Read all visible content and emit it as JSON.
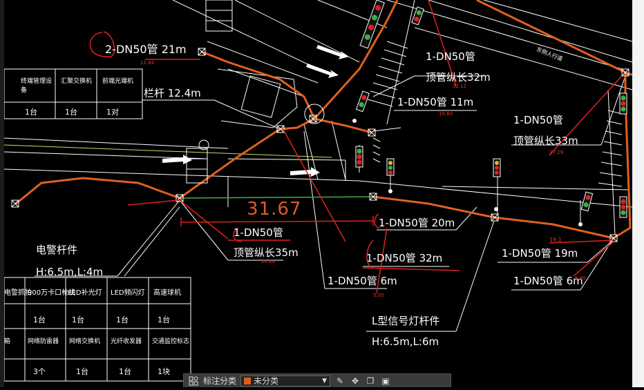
{
  "colors": {
    "background": "#000000",
    "pipe": "#e0601e",
    "line": "#ffffff",
    "dim_red": "#e03a2a",
    "green_line": "#3cb043"
  },
  "labels": {
    "l1": "2-DN50管 21m",
    "l2": "栏杆 12.4m",
    "l3": "1-DN50管",
    "l4": "顶管纵长32m",
    "l5": "1-DN50管 11m",
    "l6": "1-DN50管",
    "l7": "顶管纵长33m",
    "l8": "1-DN50管",
    "l9": "顶管纵长35m",
    "l10": "1-DN50管 20m",
    "l11": "1-DN50管 32m",
    "l12": "1-DN50管 6m",
    "l13": "1-DN50管 19m",
    "l14": "1-DN50管 6m",
    "l15": "电警杆件",
    "l16": "H:6.5m,L:4m",
    "l17": "L型信号灯杆件",
    "l18": "H:6.5m,L:6m",
    "dim": "31.67",
    "road": "东侧人行道"
  },
  "small_dims": {
    "d1": "21.84",
    "d2": "19.1",
    "d3": "27.29",
    "d4": "32.12",
    "d5": "20.00",
    "d6": "5.00",
    "d7": "6.00",
    "d8": "10.60"
  },
  "table_top": {
    "headers": [
      "终端管理设备",
      "汇聚交换机",
      "前端光端机"
    ],
    "values": [
      "1台",
      "1台",
      "1对"
    ]
  },
  "table_bottom": {
    "row1": [
      "电警抓拍",
      "900万卡口枪机",
      "LED补光灯",
      "LED频闪灯",
      "高速球机"
    ],
    "row2": [
      "",
      "1台",
      "1台",
      "1台",
      "1台"
    ],
    "row3": [
      "箱",
      "网络防雷器",
      "网络交换机",
      "光纤收发器",
      "交通监控标志"
    ],
    "row4": [
      "",
      "3个",
      "1台",
      "1台",
      "1块"
    ]
  },
  "toolbar": {
    "label": "标注分类",
    "selected": "未分类",
    "icons": [
      "category-icon",
      "edit-icon",
      "move-icon",
      "copy-icon",
      "paste-icon"
    ]
  }
}
